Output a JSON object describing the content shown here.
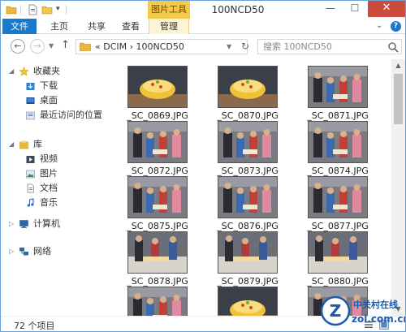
{
  "window": {
    "title": "100NCD50",
    "context_tab": "图片工具",
    "controls": {
      "minimize": "—",
      "maximize": "☐",
      "close": "✕"
    }
  },
  "ribbon": {
    "tabs": [
      "文件",
      "主页",
      "共享",
      "查看",
      "管理"
    ],
    "active_tab": "文件",
    "accent_color": "#1979ca",
    "context_color": "#f3c94e",
    "help": "?"
  },
  "address": {
    "prefix": "«",
    "path": [
      "DCIM",
      "100NCD50"
    ],
    "separator": "›"
  },
  "search": {
    "placeholder": "搜索 100NCD50"
  },
  "nav": {
    "favorites_header": "收藏夹",
    "favorites": [
      "下载",
      "桌面",
      "最近访问的位置"
    ],
    "libraries_header": "库",
    "libraries": [
      "视频",
      "图片",
      "文档",
      "音乐"
    ],
    "computer": "计算机",
    "network": "网络"
  },
  "files": [
    {
      "name": "_SC_0869.JPG",
      "scene": "cake"
    },
    {
      "name": "_SC_0870.JPG",
      "scene": "cake"
    },
    {
      "name": "_SC_0871.JPG",
      "scene": "party"
    },
    {
      "name": "_SC_0872.JPG",
      "scene": "party"
    },
    {
      "name": "_SC_0873.JPG",
      "scene": "party"
    },
    {
      "name": "_SC_0874.JPG",
      "scene": "party"
    },
    {
      "name": "_SC_0875.JPG",
      "scene": "party"
    },
    {
      "name": "_SC_0876.JPG",
      "scene": "party"
    },
    {
      "name": "_SC_0877.JPG",
      "scene": "party"
    },
    {
      "name": "_SC_0878.JPG",
      "scene": "table"
    },
    {
      "name": "_SC_0879.JPG",
      "scene": "table"
    },
    {
      "name": "_SC_0880.JPG",
      "scene": "table"
    },
    {
      "name": "",
      "scene": "party"
    },
    {
      "name": "",
      "scene": "cake"
    },
    {
      "name": "",
      "scene": "party"
    }
  ],
  "status": {
    "count": "72 个项目"
  },
  "watermark": {
    "text": "中关村在线",
    "domain": "zol.com.cn",
    "letter": "Z"
  }
}
